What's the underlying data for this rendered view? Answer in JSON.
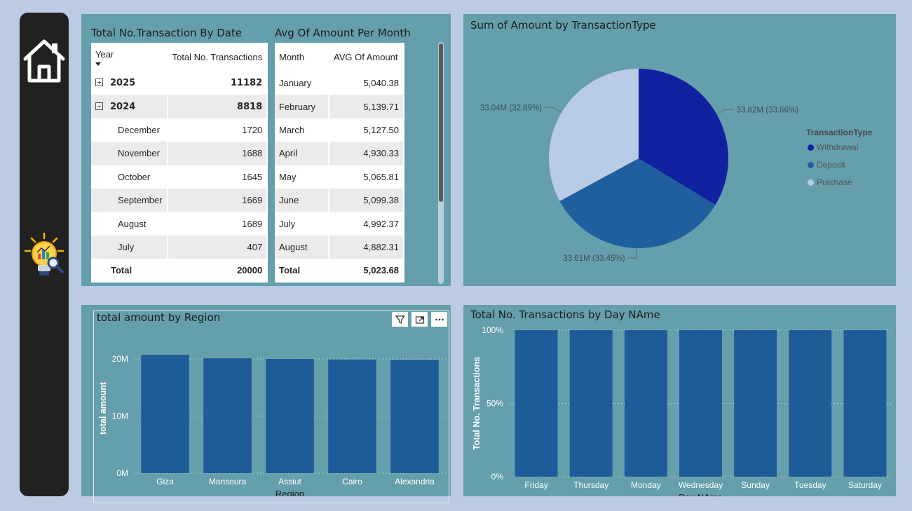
{
  "nav": {
    "icons": [
      "home-icon",
      "insight-bulb-icon"
    ]
  },
  "txn_table": {
    "title": "Total No.Transaction By Date",
    "columns": [
      "Year",
      "Total No. Transactions"
    ],
    "rows": [
      {
        "label": "2025",
        "value": "11182",
        "kind": "year",
        "expand": "plus"
      },
      {
        "label": "2024",
        "value": "8818",
        "kind": "year",
        "expand": "minus"
      },
      {
        "label": "December",
        "value": "1720",
        "kind": "month"
      },
      {
        "label": "November",
        "value": "1688",
        "kind": "month"
      },
      {
        "label": "October",
        "value": "1645",
        "kind": "month"
      },
      {
        "label": "September",
        "value": "1669",
        "kind": "month"
      },
      {
        "label": "August",
        "value": "1689",
        "kind": "month"
      },
      {
        "label": "July",
        "value": "407",
        "kind": "month"
      }
    ],
    "total": {
      "label": "Total",
      "value": "20000"
    }
  },
  "avg_table": {
    "title": "Avg Of Amount Per Month",
    "columns": [
      "Month",
      "AVG Of Amount"
    ],
    "rows": [
      {
        "label": "January",
        "value": "5,040.38"
      },
      {
        "label": "February",
        "value": "5,139.71"
      },
      {
        "label": "March",
        "value": "5,127.50"
      },
      {
        "label": "April",
        "value": "4,930.33"
      },
      {
        "label": "May",
        "value": "5,065.81"
      },
      {
        "label": "June",
        "value": "5,099.38"
      },
      {
        "label": "July",
        "value": "4,992.37"
      },
      {
        "label": "August",
        "value": "4,882.31"
      }
    ],
    "total": {
      "label": "Total",
      "value": "5,023.68"
    }
  },
  "pie": {
    "title": "Sum of Amount by TransactionType",
    "legend_title": "TransactionType",
    "colors": [
      "#1122a0",
      "#1f5f9e",
      "#b9cbe6"
    ]
  },
  "region": {
    "title": "total amount by Region",
    "header_icons": [
      "filter-icon",
      "focus-mode-icon",
      "more-options-icon"
    ],
    "header_symbols": [
      "⊽",
      "⤢",
      "⋯"
    ],
    "bar_color": "#1e5b99"
  },
  "day": {
    "title": "Total No. Transactions by Day NAme",
    "bar_color": "#1e5b99"
  },
  "chart_data": [
    {
      "type": "pie",
      "title": "Sum of Amount by TransactionType",
      "legend": "TransactionType",
      "categories": [
        "Withdrawal",
        "Deposit",
        "Purchase"
      ],
      "values": [
        33.82,
        33.61,
        33.04
      ],
      "value_unit": "M",
      "labels": [
        "33.82M (33.66%)",
        "33.61M (33.45%)",
        "33.04M (32.89%)"
      ],
      "legend_position": "right"
    },
    {
      "type": "bar",
      "title": "total amount by Region",
      "categories": [
        "Giza",
        "Mansoura",
        "Assiut",
        "Cairo",
        "Alexandria"
      ],
      "values": [
        20.7,
        20.1,
        20.0,
        19.9,
        19.8
      ],
      "xlabel": "Region",
      "ylabel": "total amount",
      "ylim": [
        0,
        22.7
      ],
      "yticks": [
        0,
        10,
        20
      ],
      "ytick_labels": [
        "0M",
        "10M",
        "20M"
      ],
      "grid": true
    },
    {
      "type": "bar",
      "title": "Total No. Transactions by Day NAme",
      "categories": [
        "Friday",
        "Thursday",
        "Monday",
        "Wednesday",
        "Sunday",
        "Tuesday",
        "Saturday"
      ],
      "values": [
        100,
        100,
        100,
        100,
        100,
        100,
        100
      ],
      "xlabel": "Day NAme",
      "ylabel": "Total No. Transactions",
      "ylim": [
        0,
        100
      ],
      "yticks": [
        0,
        50,
        100
      ],
      "ytick_labels": [
        "0%",
        "50%",
        "100%"
      ],
      "grid": true
    }
  ]
}
